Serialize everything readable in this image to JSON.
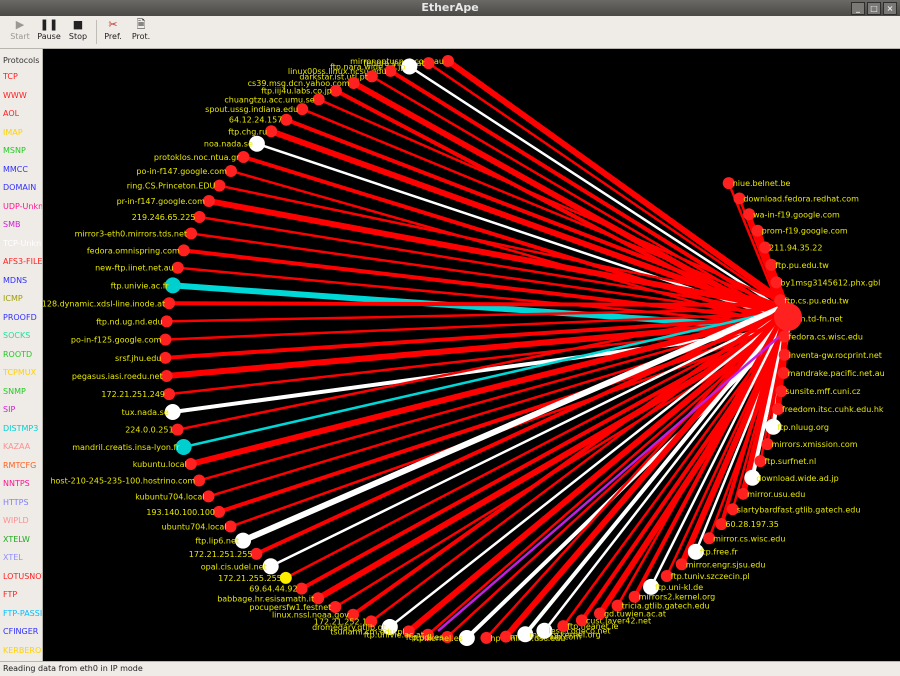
{
  "window": {
    "title": "EtherApe"
  },
  "toolbar": {
    "start": "Start",
    "pause": "Pause",
    "stop": "Stop",
    "pref": "Pref.",
    "prot": "Prot."
  },
  "sidebar": {
    "title": "Protocols",
    "items": [
      {
        "label": "TCP",
        "color": "#ff2020"
      },
      {
        "label": "WWW",
        "color": "#ff2020"
      },
      {
        "label": "AOL",
        "color": "#ff2020"
      },
      {
        "label": "IMAP",
        "color": "#ffd200"
      },
      {
        "label": "MSNP",
        "color": "#22cc22"
      },
      {
        "label": "MMCC",
        "color": "#3030ff"
      },
      {
        "label": "DOMAIN",
        "color": "#3030ff"
      },
      {
        "label": "UDP-Unkn",
        "color": "#ff1493"
      },
      {
        "label": "SMB",
        "color": "#d020d0"
      },
      {
        "label": "TCP-Unkn",
        "color": "#ffffff"
      },
      {
        "label": "AFS3-FILE",
        "color": "#ff2020"
      },
      {
        "label": "MDNS",
        "color": "#3030ff"
      },
      {
        "label": "ICMP",
        "color": "#a0a000"
      },
      {
        "label": "PROOFD",
        "color": "#3030ff"
      },
      {
        "label": "SOCKS",
        "color": "#20e0a0"
      },
      {
        "label": "ROOTD",
        "color": "#22cc22"
      },
      {
        "label": "TCPMUX",
        "color": "#ffd200"
      },
      {
        "label": "SNMP",
        "color": "#22cc22"
      },
      {
        "label": "SIP",
        "color": "#d020d0"
      },
      {
        "label": "DISTMP3",
        "color": "#00d0d0"
      },
      {
        "label": "KAZAA",
        "color": "#ff9090"
      },
      {
        "label": "RMTCFG",
        "color": "#ff6020"
      },
      {
        "label": "NNTPS",
        "color": "#ff1493"
      },
      {
        "label": "HTTPS",
        "color": "#8080ff"
      },
      {
        "label": "WIPLD",
        "color": "#ff9090"
      },
      {
        "label": "XTELW",
        "color": "#22aa22"
      },
      {
        "label": "XTEL",
        "color": "#9090ff"
      },
      {
        "label": "LOTUSNOTE",
        "color": "#ff2020"
      },
      {
        "label": "FTP",
        "color": "#ff2020"
      },
      {
        "label": "FTP-PASSIVE",
        "color": "#00c0ff"
      },
      {
        "label": "CFINGER",
        "color": "#3030ff"
      },
      {
        "label": "KERBEROS",
        "color": "#ffd200"
      }
    ]
  },
  "graph": {
    "nodes": [
      {
        "label": "mirror.optusnet.com.au",
        "color": "#ff2020"
      },
      {
        "label": "fedora.inode.at",
        "color": "#ff2020"
      },
      {
        "label": "ftp.nara.wide.ad.jp",
        "color": "#ffffff"
      },
      {
        "label": "linux00ss.linux.ncsu.edu",
        "color": "#ff2020"
      },
      {
        "label": "darkstar.ist.utl.pt",
        "color": "#ff2020"
      },
      {
        "label": "cs39.msg.dcn.yahoo.com",
        "color": "#ff2020"
      },
      {
        "label": "ftp.iij4u.labs.co.jp",
        "color": "#ff2020"
      },
      {
        "label": "chuangtzu.acc.umu.se",
        "color": "#ff2020"
      },
      {
        "label": "spout.ussg.indiana.edu",
        "color": "#ff2020"
      },
      {
        "label": "64.12.24.157",
        "color": "#ff2020"
      },
      {
        "label": "ftp.chg.ru",
        "color": "#ff2020"
      },
      {
        "label": "noa.nada.se",
        "color": "#ffffff"
      },
      {
        "label": "protoklos.noc.ntua.gr",
        "color": "#ff2020"
      },
      {
        "label": "po-in-f147.google.com",
        "color": "#ff2020"
      },
      {
        "label": "ring.CS.Princeton.EDU",
        "color": "#ff2020"
      },
      {
        "label": "pr-in-f147.google.com",
        "color": "#ff2020"
      },
      {
        "label": "219.246.65.225",
        "color": "#ff2020"
      },
      {
        "label": "mirror3-eth0.mirrors.tds.net",
        "color": "#ff2020"
      },
      {
        "label": "fedora.omnispring.com",
        "color": "#ff2020"
      },
      {
        "label": "new-ftp.iinet.net.au",
        "color": "#ff2020"
      },
      {
        "label": "ftp.univie.ac.fr",
        "color": "#00cfcf"
      },
      {
        "label": "83-65-241-128.dynamic.xdsl-line.inode.at",
        "color": "#ff2020"
      },
      {
        "label": "ftp.nd.ug.nd.edu",
        "color": "#ff2020"
      },
      {
        "label": "po-in-f125.google.com",
        "color": "#ff2020"
      },
      {
        "label": "srsf.jhu.edu",
        "color": "#ff2020"
      },
      {
        "label": "pegasus.iasi.roedu.net",
        "color": "#ff2020"
      },
      {
        "label": "172.21.251.249",
        "color": "#ff2020"
      },
      {
        "label": "tux.nada.se",
        "color": "#ffffff"
      },
      {
        "label": "224.0.0.251",
        "color": "#ff2020"
      },
      {
        "label": "mandril.creatis.insa-lyon.fr",
        "color": "#00cfcf"
      },
      {
        "label": "kubuntu.local",
        "color": "#ff2020"
      },
      {
        "label": "host-210-245-235-100.hostrino.com",
        "color": "#ff2020"
      },
      {
        "label": "kubuntu704.local",
        "color": "#ff2020"
      },
      {
        "label": "193.140.100.100",
        "color": "#ff2020"
      },
      {
        "label": "ubuntu704.local",
        "color": "#ff2020"
      },
      {
        "label": "ftp.lip6.net",
        "color": "#ffffff"
      },
      {
        "label": "172.21.251.255",
        "color": "#ff2020"
      },
      {
        "label": "opal.cis.udel.net",
        "color": "#ffffff"
      },
      {
        "label": "172.21.255.255",
        "color": "#ffee00"
      },
      {
        "label": "69.64.44.92",
        "color": "#ff2020"
      },
      {
        "label": "babbage.hr.esisamath.it",
        "color": "#ff2020"
      },
      {
        "label": "pocupersfw1.festnet",
        "color": "#ff2020"
      },
      {
        "label": "linux.nssl.noaa.gov",
        "color": "#ff2020"
      },
      {
        "label": "172.21.252.1",
        "color": "#ff2020"
      },
      {
        "label": "dromedary.gtlib.gt",
        "color": "#ffffff"
      },
      {
        "label": "tsunami.cm.edu.pl",
        "color": "#ff2020"
      },
      {
        "label": "ftp.univie.ac.at",
        "color": "#ff2020"
      },
      {
        "label": "ftp.udl.es",
        "color": "#ff2020"
      },
      {
        "label": "ftp.kernel.es",
        "color": "#ffffff"
      },
      {
        "label": "hpc-mirror.usc.edu",
        "color": "#ff2020"
      },
      {
        "label": "mirror.csclub.com",
        "color": "#ff2020"
      },
      {
        "label": "mirrors.kernel.org",
        "color": "#ffffff"
      },
      {
        "label": "less.cogeco.net",
        "color": "#ffffff"
      },
      {
        "label": "ftp.heanet.ie",
        "color": "#ff2020"
      },
      {
        "label": "cust.layer42.net",
        "color": "#ff2020"
      },
      {
        "label": "gd.tuwien.ac.at",
        "color": "#ff2020"
      },
      {
        "label": "tricia.gtlib.gatech.edu",
        "color": "#ff2020"
      },
      {
        "label": "mirrors2.kernel.org",
        "color": "#ff2020"
      },
      {
        "label": "ftp.uni-kl.de",
        "color": "#ffffff"
      },
      {
        "label": "ftp.tuniv.szczecin.pl",
        "color": "#ff2020"
      },
      {
        "label": "mirror.engr.sjsu.edu",
        "color": "#ff2020"
      },
      {
        "label": "ftp.free.fr",
        "color": "#ffffff"
      },
      {
        "label": "mirror.cs.wisc.edu",
        "color": "#ff2020"
      },
      {
        "label": "60.28.197.35",
        "color": "#ff2020"
      },
      {
        "label": "slartybardfast.gtlib.gatech.edu",
        "color": "#ff2020"
      },
      {
        "label": "mirror.usu.edu",
        "color": "#ff2020"
      },
      {
        "label": "download.wide.ad.jp",
        "color": "#ffffff"
      },
      {
        "label": "ftp.surfnet.nl",
        "color": "#ff2020"
      },
      {
        "label": "mirrors.xmission.com",
        "color": "#ff2020"
      },
      {
        "label": "ftp.nluug.org",
        "color": "#ffffff"
      },
      {
        "label": "freedom.itsc.cuhk.edu.hk",
        "color": "#ff2020"
      },
      {
        "label": "sunsite.mff.cuni.cz",
        "color": "#ff2020"
      },
      {
        "label": "mandrake.pacific.net.au",
        "color": "#ff2020"
      },
      {
        "label": "inventa-gw.rocprint.net",
        "color": "#ff2020"
      },
      {
        "label": "fedora.cs.wisc.edu",
        "color": "#ff2020"
      },
      {
        "label": "titan.td-fn.net",
        "color": "#ff2020"
      },
      {
        "label": "ftp.cs.pu.edu.tw",
        "color": "#ff2020"
      },
      {
        "label": "by1msg3145612.phx.gbl",
        "color": "#ff2020"
      },
      {
        "label": "ftp.pu.edu.tw",
        "color": "#ff2020"
      },
      {
        "label": "211.94.35.22",
        "color": "#ff2020"
      },
      {
        "label": "prom-f19.google.com",
        "color": "#ff2020"
      },
      {
        "label": "wa-in-f19.google.com",
        "color": "#ff2020"
      },
      {
        "label": "download.fedora.redhat.com",
        "color": "#ff2020"
      },
      {
        "label": "niue.belnet.be",
        "color": "#ff2020"
      }
    ]
  },
  "status": {
    "text": "Reading data from eth0 in IP mode"
  }
}
